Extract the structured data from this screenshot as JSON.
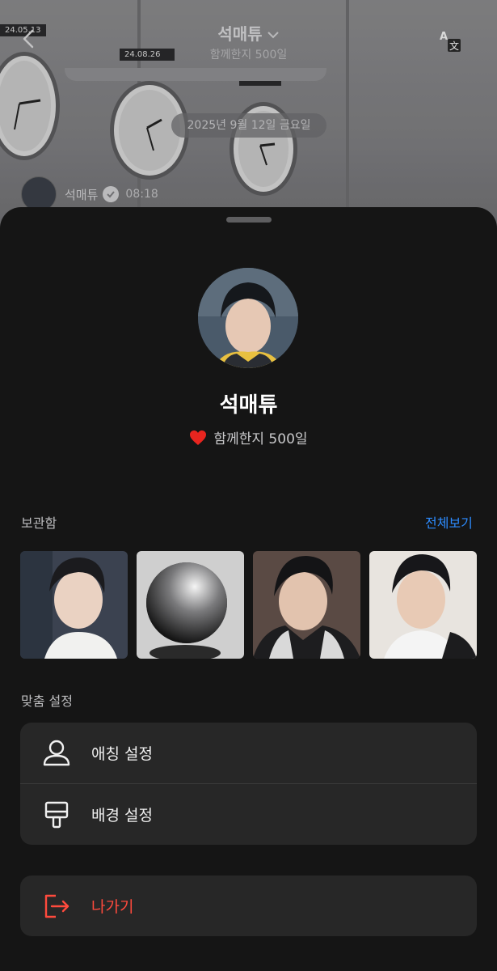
{
  "chat_header": {
    "name": "석매튜",
    "subtitle": "함께한지 500일"
  },
  "chat_background": {
    "date_pill": "2025년 9월 12일 금요일",
    "message": {
      "sender": "석매튜",
      "time": "08:18"
    },
    "clock_labels": [
      "24.05.13",
      "24.08.26"
    ]
  },
  "profile": {
    "name": "석매튜",
    "together_text": "함께한지 500일",
    "heart_color": "#e8251f"
  },
  "storage": {
    "title": "보관함",
    "see_all": "전체보기",
    "accent_color": "#2d8cff",
    "thumbnails": [
      "photo-1",
      "photo-2",
      "photo-3",
      "photo-4"
    ]
  },
  "custom_settings": {
    "title": "맞춤 설정",
    "items": [
      {
        "label": "애칭 설정",
        "icon": "person-icon"
      },
      {
        "label": "배경 설정",
        "icon": "paint-brush-icon"
      }
    ]
  },
  "exit": {
    "label": "나가기",
    "icon": "exit-icon",
    "color": "#ff4a3d"
  }
}
